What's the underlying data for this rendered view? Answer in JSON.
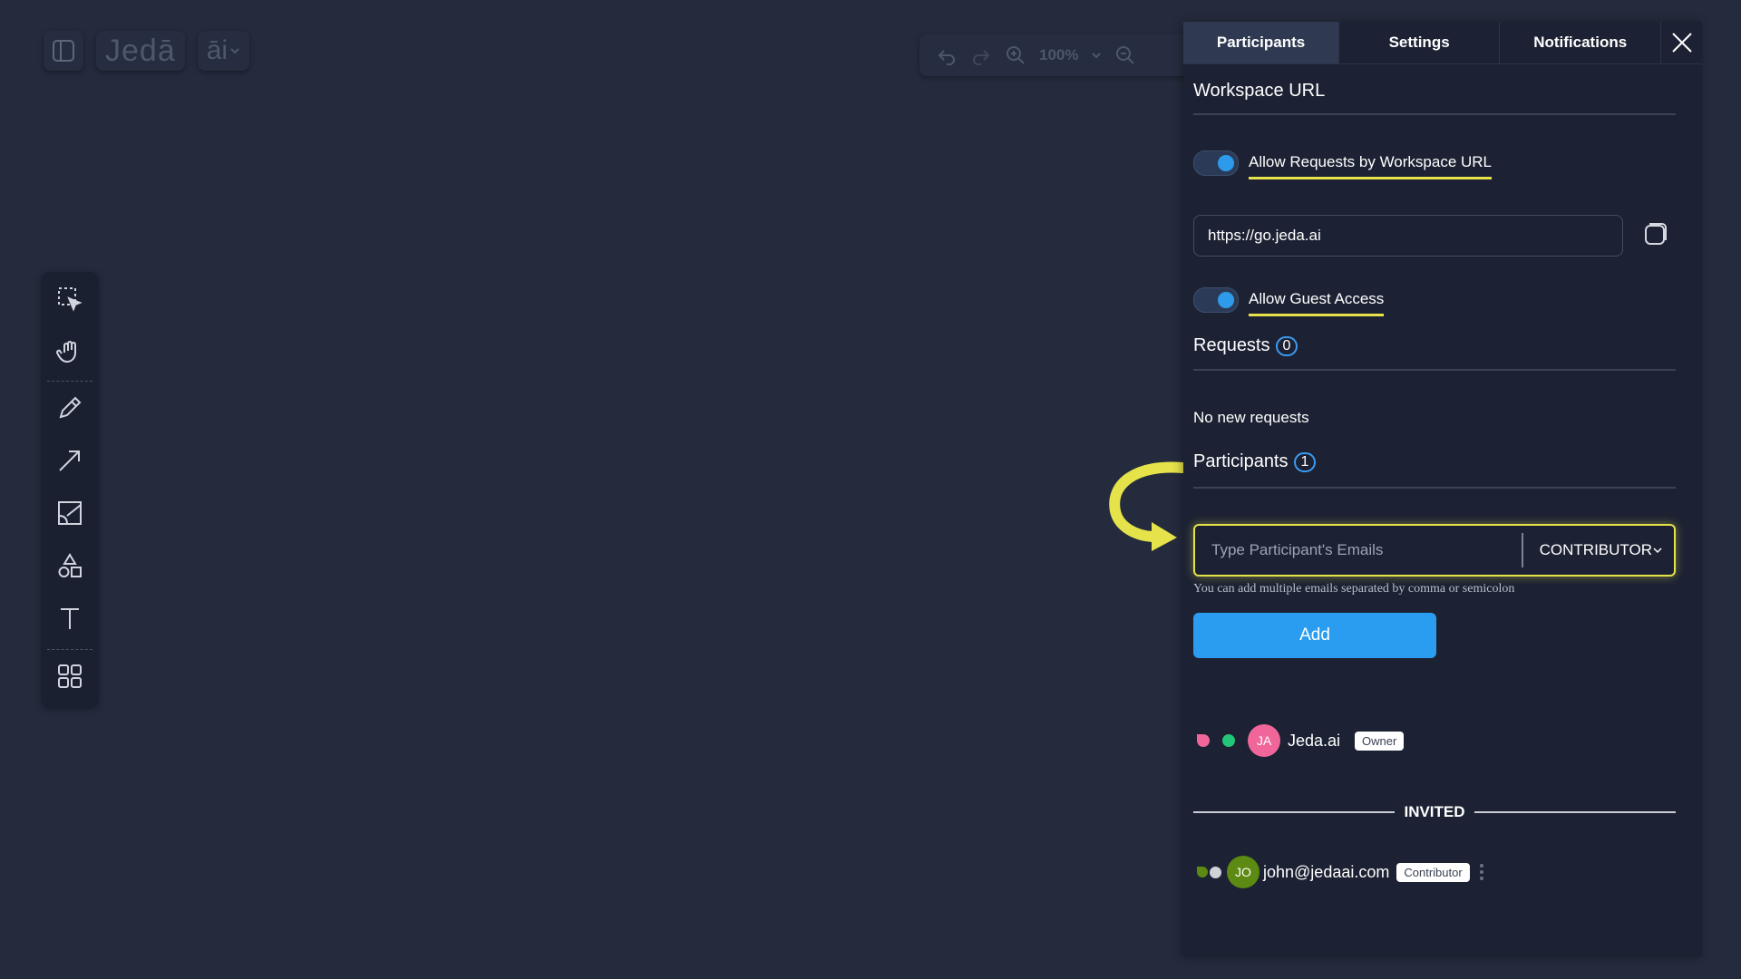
{
  "app": {
    "logo": "Jedā",
    "ai_label": "āi"
  },
  "toolbar": {
    "zoom": "100%"
  },
  "tabs": [
    "Participants",
    "Settings",
    "Notifications"
  ],
  "workspace_url": {
    "title": "Workspace URL",
    "allow_requests_label": "Allow Requests by Workspace URL",
    "url_value": "https://go.jeda.ai",
    "allow_guest_label": "Allow Guest Access"
  },
  "requests": {
    "title": "Requests",
    "count": "0",
    "empty_text": "No new requests"
  },
  "participants": {
    "title": "Participants",
    "count": "1",
    "email_placeholder": "Type Participant's Emails",
    "role_selected": "CONTRIBUTOR",
    "hint": "You can add multiple emails separated by comma or semicolon",
    "add_label": "Add",
    "owner": {
      "initials": "JA",
      "name": "Jeda.ai",
      "role": "Owner"
    },
    "invited_label": "INVITED",
    "invited": {
      "initials": "JO",
      "email": "john@jedaai.com",
      "role": "Contributor"
    }
  },
  "colors": {
    "background": "#242b3d",
    "panel": "#1c2233",
    "accent_blue": "#2a9df0",
    "highlight_yellow": "#e6e24a",
    "owner_avatar": "#f0669a",
    "invited_avatar": "#5c8a12"
  }
}
